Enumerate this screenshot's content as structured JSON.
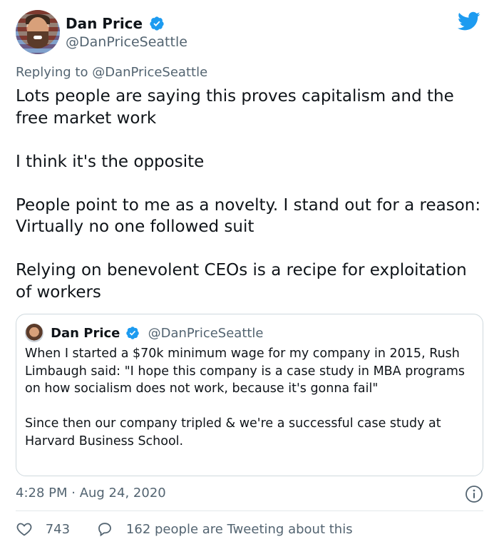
{
  "author": {
    "name": "Dan Price",
    "handle": "@DanPriceSeattle",
    "avatar_icon": "profile-avatar",
    "verified_color": "#1d9bf0"
  },
  "brand": {
    "icon": "twitter-bird-icon",
    "color": "#1d9bf0"
  },
  "reply": {
    "prefix": "Replying to",
    "handle": "@DanPriceSeattle"
  },
  "tweet": {
    "paragraphs": [
      "Lots people are saying this proves capitalism and the free market work",
      "I think it's the opposite",
      "People point to me as a novelty. I stand out for a reason: Virtually no one followed suit",
      "Relying on benevolent CEOs is a recipe for exploitation of workers"
    ]
  },
  "quoted": {
    "name": "Dan Price",
    "handle": "@DanPriceSeattle",
    "paragraphs": [
      "When I started a $70k minimum wage for my company in 2015, Rush Limbaugh said: \"I hope this company is a case study in MBA programs on how socialism does not work, because it's gonna fail\"",
      "Since then our company tripled & we're a successful case study at Harvard Business School."
    ]
  },
  "meta": {
    "timestamp": "4:28 PM · Aug 24, 2020"
  },
  "stats": {
    "likes": "743",
    "tweeting": "162 people are Tweeting about this"
  }
}
